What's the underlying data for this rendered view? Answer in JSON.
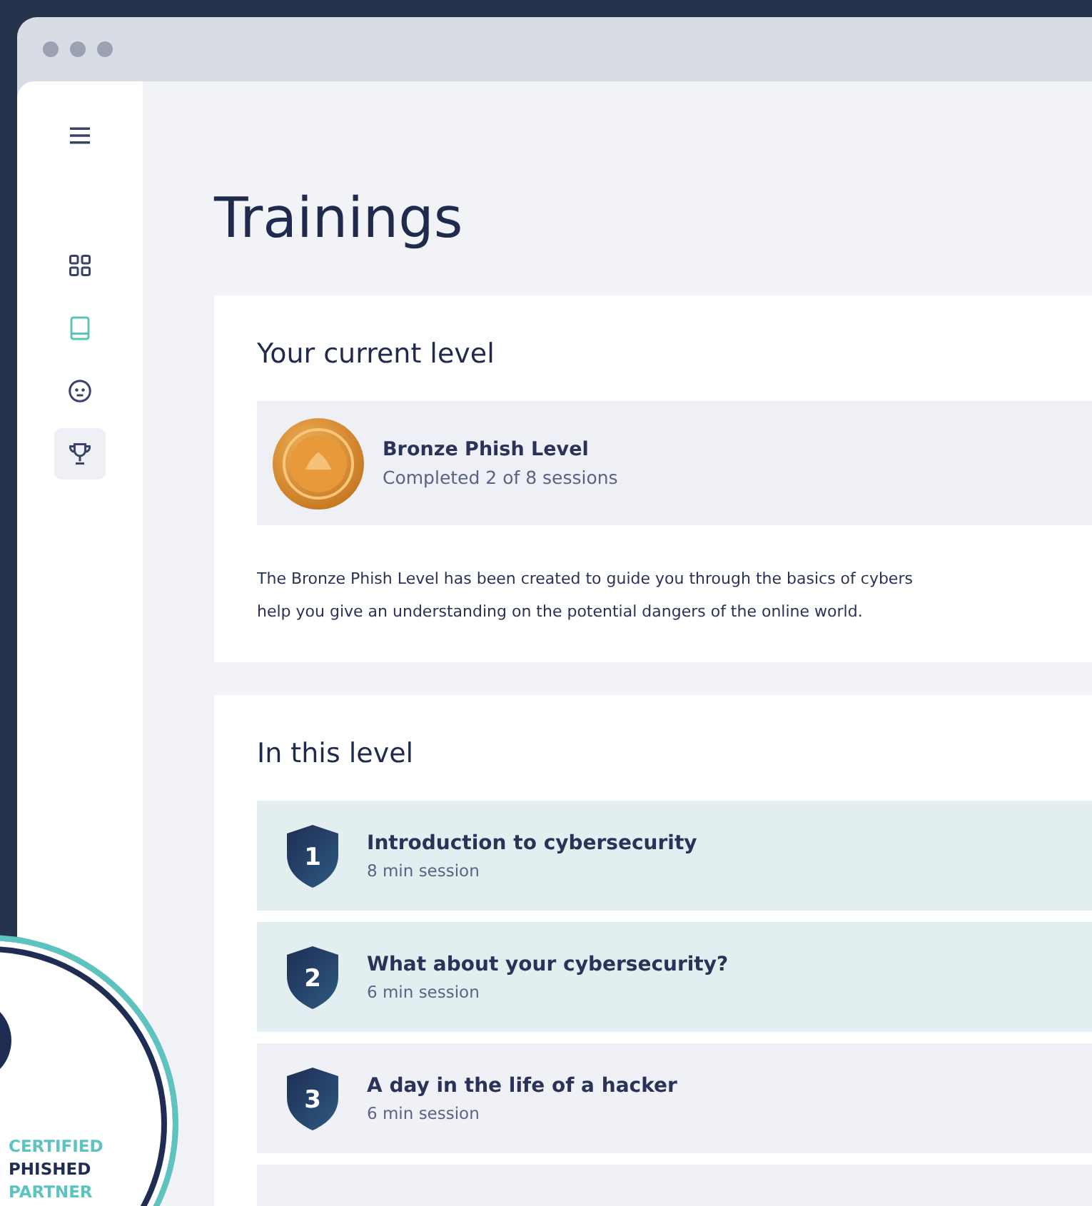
{
  "sidebar": {
    "items": [
      {
        "kind": "grid",
        "selected": false,
        "color": "#3a4466"
      },
      {
        "kind": "book",
        "selected": false,
        "color": "#5cc3b8"
      },
      {
        "kind": "face",
        "selected": false,
        "color": "#3a4466"
      },
      {
        "kind": "trophy",
        "selected": true,
        "color": "#3a4466"
      }
    ]
  },
  "page_title": "Trainings",
  "current_level": {
    "heading": "Your current level",
    "name": "Bronze Phish Level",
    "progress": "Completed 2 of 8 sessions",
    "description": [
      "The Bronze Phish Level has been created to guide you through the basics of cybers",
      "help you give an understanding on the potential dangers of the online world."
    ]
  },
  "level_sessions": {
    "heading": "In this level",
    "sessions": [
      {
        "number": "1",
        "title": "Introduction to cybersecurity",
        "duration": "8 min session",
        "completed": true
      },
      {
        "number": "2",
        "title": "What about your cybersecurity?",
        "duration": "6 min session",
        "completed": true
      },
      {
        "number": "3",
        "title": "A day in the life of a hacker",
        "duration": "6 min session",
        "completed": false
      }
    ]
  },
  "badge": {
    "lines": [
      "CERTIFIED",
      "PHISHED",
      "PARTNER"
    ]
  }
}
